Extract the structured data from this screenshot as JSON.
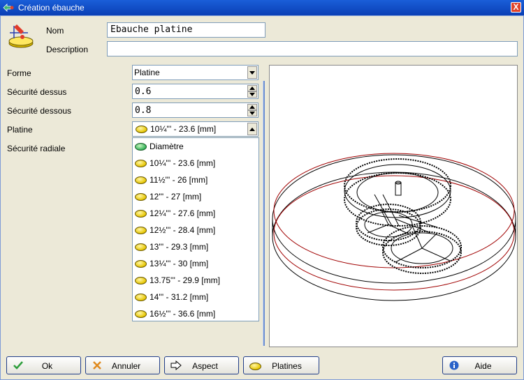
{
  "window": {
    "title": "Création ébauche",
    "close_label": "X"
  },
  "header": {
    "nom_label": "Nom",
    "nom_value": "Ebauche platine",
    "description_label": "Description",
    "description_value": ""
  },
  "form": {
    "forme_label": "Forme",
    "forme_value": "Platine",
    "securite_dessus_label": "Sécurité dessus",
    "securite_dessus_value": "0.6",
    "securite_dessous_label": "Sécurité dessous",
    "securite_dessous_value": "0.8",
    "platine_label": "Platine",
    "platine_value": "10¼''' - 23.6 [mm]",
    "securite_radiale_label": "Sécurité radiale"
  },
  "dropdown": {
    "items": [
      {
        "label": "Diamètre",
        "icon": "green-disc-icon"
      },
      {
        "label": "10¼''' - 23.6 [mm]",
        "icon": "yellow-disc-icon"
      },
      {
        "label": "11½''' - 26 [mm]",
        "icon": "yellow-disc-icon"
      },
      {
        "label": "12''' - 27 [mm]",
        "icon": "yellow-disc-icon"
      },
      {
        "label": "12¼''' - 27.6 [mm]",
        "icon": "yellow-disc-icon"
      },
      {
        "label": "12½''' - 28.4 [mm]",
        "icon": "yellow-disc-icon"
      },
      {
        "label": "13''' - 29.3 [mm]",
        "icon": "yellow-disc-icon"
      },
      {
        "label": "13¼''' - 30 [mm]",
        "icon": "yellow-disc-icon"
      },
      {
        "label": "13.75''' - 29.9 [mm]",
        "icon": "yellow-disc-icon"
      },
      {
        "label": "14''' - 31.2 [mm]",
        "icon": "yellow-disc-icon"
      },
      {
        "label": "16½''' - 36.6 [mm]",
        "icon": "yellow-disc-icon"
      }
    ]
  },
  "buttons": {
    "ok": "Ok",
    "annuler": "Annuler",
    "aspect": "Aspect",
    "platines": "Platines",
    "aide": "Aide"
  },
  "colors": {
    "titlebar": "#0A3FB5",
    "accent_red": "#A00000",
    "wire": "#000000"
  }
}
